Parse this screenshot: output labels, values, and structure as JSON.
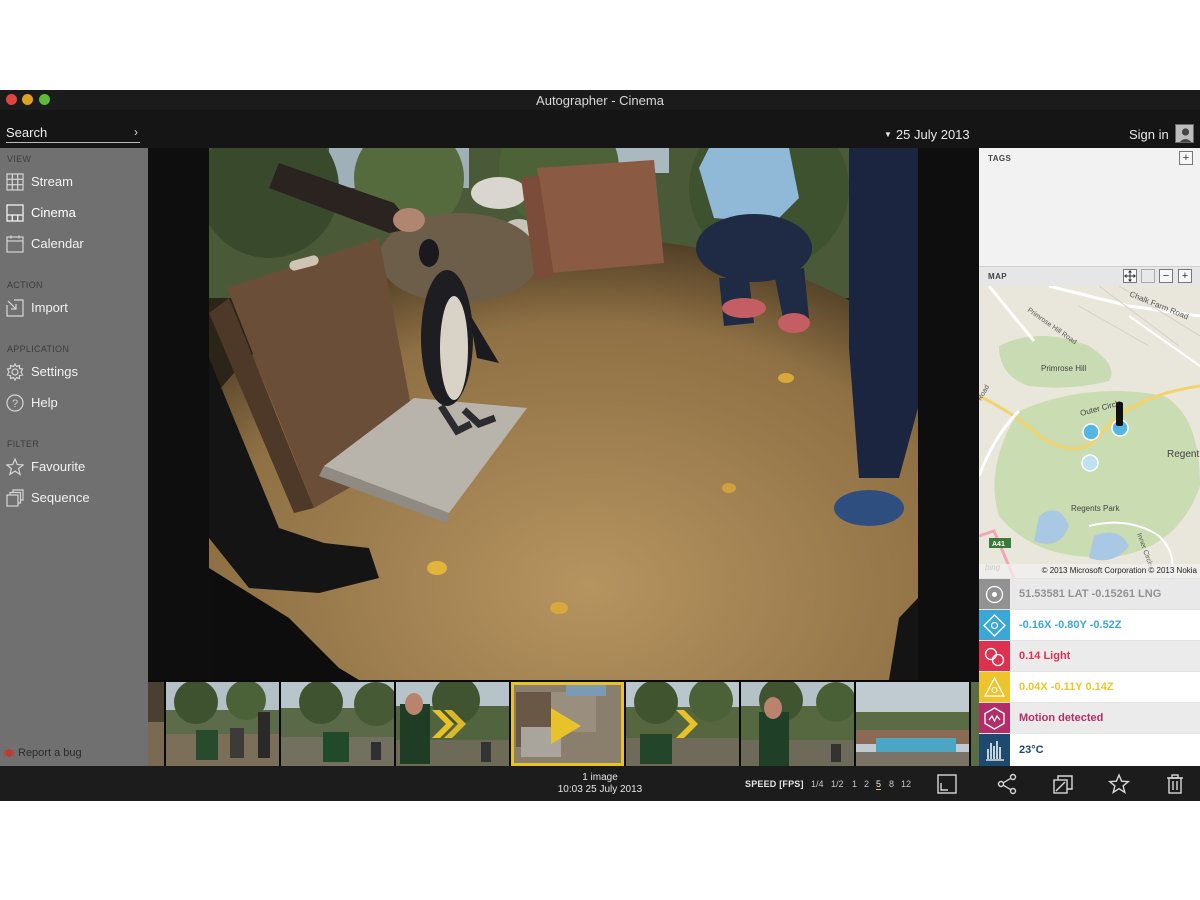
{
  "window": {
    "title": "Autographer - Cinema"
  },
  "topbar": {
    "search_placeholder": "Search",
    "search_chevron": "›",
    "date": "25 July 2013",
    "signin": "Sign in"
  },
  "sidebar": {
    "sections": {
      "view": "VIEW",
      "action": "ACTION",
      "application": "APPLICATION",
      "filter": "FILTER"
    },
    "items": {
      "stream": "Stream",
      "cinema": "Cinema",
      "calendar": "Calendar",
      "import": "Import",
      "settings": "Settings",
      "help": "Help",
      "favourite": "Favourite",
      "sequence": "Sequence"
    },
    "active": "cinema",
    "report_bug": "Report a bug"
  },
  "right_panel": {
    "tags_title": "TAGS",
    "map_title": "MAP",
    "map_labels": {
      "chalk_farm": "Chalk Farm Road",
      "primrose_road": "Primrose Hill Road",
      "primrose_hill": "Primrose Hill",
      "outer_circle": "Outer Circle",
      "regents": "Regent",
      "regents_park": "Regents Park",
      "road": "Road",
      "inner_circle": "Inner Circle",
      "a41": "A41",
      "bing": "bing"
    },
    "map_credit": "© 2013 Microsoft Corporation © 2013 Nokia",
    "sensors": {
      "gps": "51.53581 LAT -0.15261 LNG",
      "accelerometer": "-0.16X -0.80Y -0.52Z",
      "light": "0.14 Light",
      "magnetometer": "0.04X -0.11Y 0.14Z",
      "motion": "Motion detected",
      "temperature": "23°C"
    },
    "colors": {
      "gps": "#929292",
      "accelerometer": "#3aa7d6",
      "light": "#dd3150",
      "magnetometer": "#eec42c",
      "motion": "#b32e69",
      "temperature": "#1d4a6e"
    }
  },
  "bottombar": {
    "image_count": "1 image",
    "image_datetime": "10:03 25 July 2013",
    "speed_label": "SPEED [FPS]",
    "speed_options": [
      "1/4",
      "1/2",
      "1",
      "2",
      "5",
      "8",
      "12"
    ],
    "speed_selected": "5"
  },
  "accent_color": "#e8c229"
}
